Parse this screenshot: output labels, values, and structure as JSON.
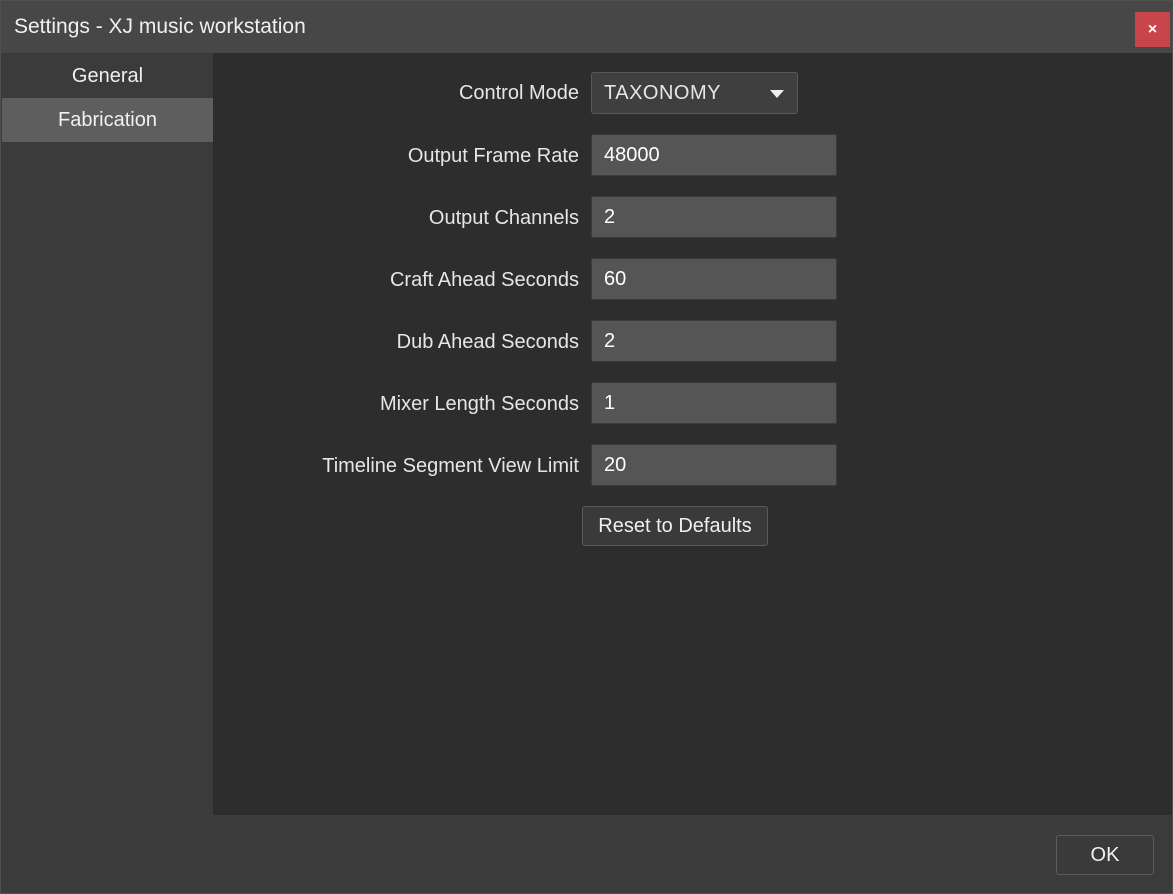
{
  "window": {
    "title": "Settings - XJ music workstation",
    "close_label": "×"
  },
  "sidebar": {
    "items": [
      {
        "label": "General",
        "selected": false
      },
      {
        "label": "Fabrication",
        "selected": true
      }
    ]
  },
  "form": {
    "control_mode": {
      "label": "Control Mode",
      "value": "TAXONOMY"
    },
    "output_frame_rate": {
      "label": "Output Frame Rate",
      "value": "48000"
    },
    "output_channels": {
      "label": "Output Channels",
      "value": "2"
    },
    "craft_ahead_seconds": {
      "label": "Craft Ahead Seconds",
      "value": "60"
    },
    "dub_ahead_seconds": {
      "label": "Dub Ahead Seconds",
      "value": "2"
    },
    "mixer_length_seconds": {
      "label": "Mixer Length Seconds",
      "value": "1"
    },
    "timeline_segment_view_limit": {
      "label": "Timeline Segment View Limit",
      "value": "20"
    },
    "reset_label": "Reset to Defaults"
  },
  "footer": {
    "ok_label": "OK"
  },
  "colors": {
    "close_button": "#c8464b",
    "selected_nav": "#5e5e5e",
    "field_background": "#555555"
  },
  "icons": {
    "close": "close-icon",
    "dropdown": "chevron-down-icon"
  }
}
